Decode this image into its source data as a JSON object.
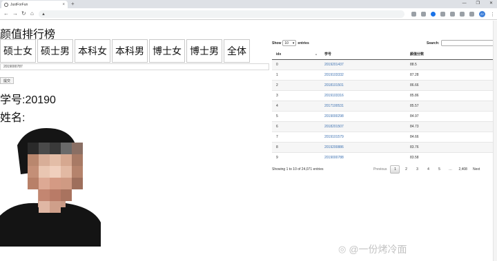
{
  "browser": {
    "tab_title": "JustForFun",
    "tab_close": "×",
    "new_tab": "+",
    "window_controls": [
      "—",
      "❐",
      "✕"
    ],
    "nav": {
      "back": "←",
      "forward": "→",
      "reload": "↻",
      "home": "⌂"
    },
    "lock_icon": "▲",
    "url": "",
    "profile_initials": "ZY",
    "menu": "⋮"
  },
  "page": {
    "title": "颜值排行榜",
    "categories": [
      "硕士女",
      "硕士男",
      "本科女",
      "本科男",
      "博士女",
      "博士男",
      "全体"
    ],
    "student_id_input_value": "2019000787",
    "submit_label": "提交",
    "id_line": "学号:20190",
    "name_line": "姓名:"
  },
  "table": {
    "length_label_pre": "Show",
    "length_value": "10",
    "length_caret": "▾",
    "length_label_post": "entries",
    "search_label": "Search:",
    "search_value": "",
    "sort_icon": "▲",
    "columns": [
      "idx",
      "学号",
      "颜值分数"
    ],
    "rows": [
      [
        "0",
        "2019201437",
        "88.5"
      ],
      [
        "1",
        "2019103332",
        "87.28"
      ],
      [
        "2",
        "2018101501",
        "86.66"
      ],
      [
        "3",
        "2019103316",
        "85.86"
      ],
      [
        "4",
        "2017100531",
        "85.57"
      ],
      [
        "5",
        "2019000298",
        "84.97"
      ],
      [
        "6",
        "2018201507",
        "84.73"
      ],
      [
        "7",
        "2019101579",
        "84.66"
      ],
      [
        "8",
        "2019200886",
        "83.76"
      ],
      [
        "9",
        "2019000788",
        "83.58"
      ]
    ],
    "info": "Showing 1 to 10 of 24,071 entries",
    "pagination": {
      "previous": "Previous",
      "pages": [
        "1",
        "2",
        "3",
        "4",
        "5",
        "…",
        "2,408"
      ],
      "next": "Next",
      "current": "1"
    }
  },
  "watermark": {
    "logo": "◎",
    "text": "@一份烤冷面"
  },
  "colors": {
    "link": "#3a6fb0",
    "profile": "#3d7fd9",
    "header_border": "#555555"
  }
}
